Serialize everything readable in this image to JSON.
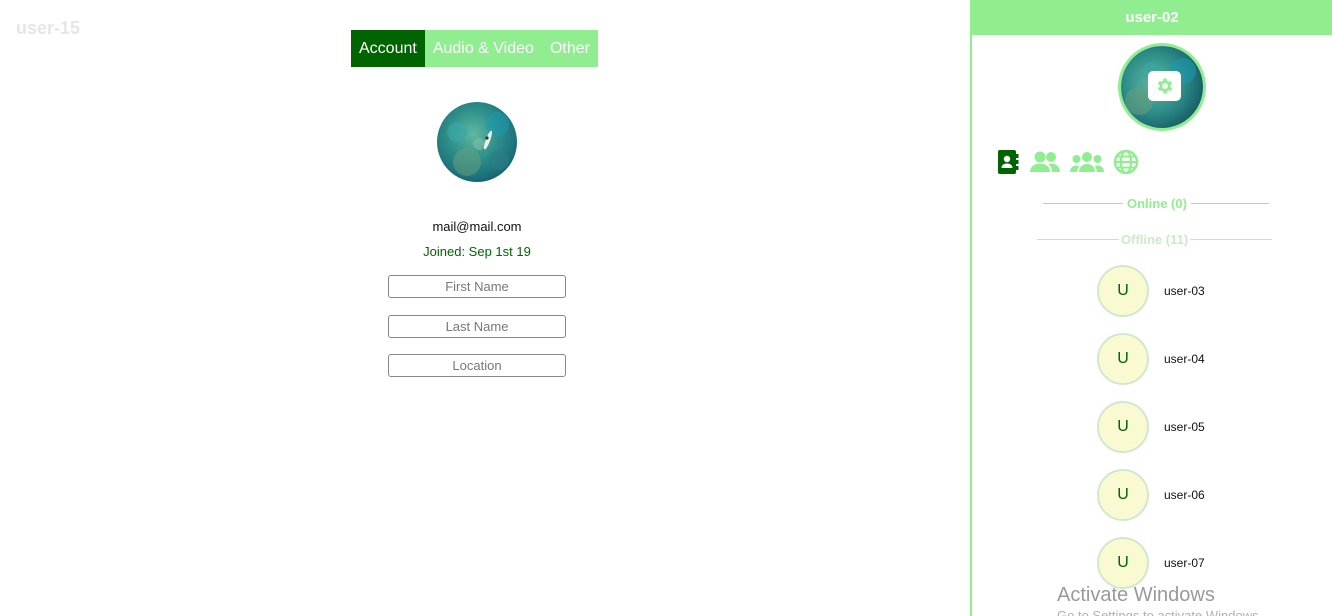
{
  "room": {
    "title": "user-15"
  },
  "tabs": [
    {
      "label": "Account",
      "active": true
    },
    {
      "label": "Audio & Video",
      "active": false
    },
    {
      "label": "Other",
      "active": false
    }
  ],
  "profile": {
    "avatar": "ocean-kayak-photo",
    "email": "mail@mail.com",
    "joined": "Joined: Sep 1st 19",
    "fields": [
      {
        "placeholder": "First Name",
        "value": ""
      },
      {
        "placeholder": "Last Name",
        "value": ""
      },
      {
        "placeholder": "Location",
        "value": ""
      }
    ]
  },
  "sidebar": {
    "current_user": "user-02",
    "settings_icon": "gear-icon",
    "nav_icons": [
      "contact-book-icon",
      "friends-icon",
      "group-icon",
      "globe-icon"
    ],
    "online_label": "Online (0)",
    "offline_label": "Offline (11)",
    "users": [
      {
        "initial": "U",
        "name": "user-03"
      },
      {
        "initial": "U",
        "name": "user-04"
      },
      {
        "initial": "U",
        "name": "user-05"
      },
      {
        "initial": "U",
        "name": "user-06"
      },
      {
        "initial": "U",
        "name": "user-07"
      }
    ]
  },
  "watermark": {
    "title": "Activate Windows",
    "subtitle": "Go to Settings to activate Windows."
  },
  "colors": {
    "accent": "#90ee90",
    "dark_green": "#006400",
    "avatar_bg": "#fafad2"
  }
}
